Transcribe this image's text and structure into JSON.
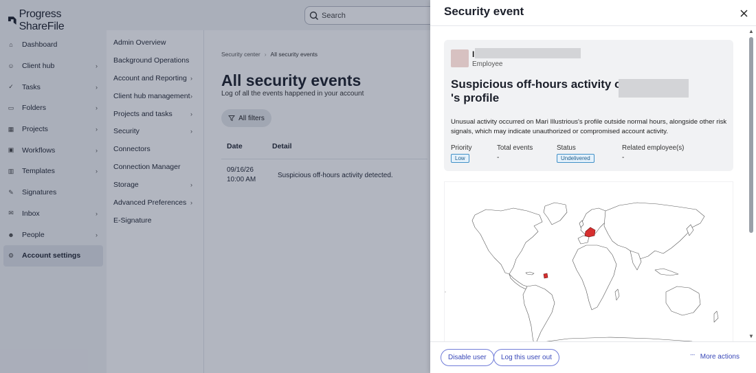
{
  "app": {
    "brand": "Progress ShareFile",
    "search": {
      "placeholder": "Search",
      "value": ""
    },
    "sidebar": {
      "items": [
        {
          "label": "Dashboard",
          "icon": "home-icon",
          "has_submenu": false,
          "active": false
        },
        {
          "label": "Client hub",
          "icon": "client-hub-icon",
          "has_submenu": true,
          "active": false
        },
        {
          "label": "Tasks",
          "icon": "check-icon",
          "has_submenu": true,
          "active": false
        },
        {
          "label": "Folders",
          "icon": "folder-icon",
          "has_submenu": true,
          "active": false
        },
        {
          "label": "Projects",
          "icon": "projects-icon",
          "has_submenu": true,
          "active": false
        },
        {
          "label": "Workflows",
          "icon": "workflow-icon",
          "has_submenu": true,
          "active": false
        },
        {
          "label": "Templates",
          "icon": "template-icon",
          "has_submenu": true,
          "active": false
        },
        {
          "label": "Signatures",
          "icon": "pen-icon",
          "has_submenu": false,
          "active": false
        },
        {
          "label": "Inbox",
          "icon": "inbox-icon",
          "has_submenu": true,
          "active": false
        },
        {
          "label": "People",
          "icon": "people-icon",
          "has_submenu": true,
          "active": false
        },
        {
          "label": "Account settings",
          "icon": "account-settings-icon",
          "has_submenu": false,
          "active": true
        }
      ]
    },
    "settings_menu": {
      "items": [
        {
          "label": "Admin Overview",
          "has_submenu": false
        },
        {
          "label": "Background Operations",
          "has_submenu": false
        },
        {
          "label": "Account and Reporting",
          "has_submenu": true
        },
        {
          "label": "Client hub management",
          "has_submenu": true
        },
        {
          "label": "Projects and tasks",
          "has_submenu": true
        },
        {
          "label": "Security",
          "has_submenu": true
        },
        {
          "label": "Connectors",
          "has_submenu": false
        },
        {
          "label": "Connection Manager",
          "has_submenu": false
        },
        {
          "label": "Storage",
          "has_submenu": true
        },
        {
          "label": "Advanced Preferences",
          "has_submenu": true
        },
        {
          "label": "E-Signature",
          "has_submenu": false
        }
      ]
    },
    "main": {
      "breadcrumb": [
        "Security center",
        "All security events"
      ],
      "title": "All security events",
      "subtitle": "Log of all the events happened in your account",
      "filters_label": "All filters",
      "table": {
        "columns": [
          "Date",
          "Detail"
        ],
        "rows": [
          {
            "date": "09/16/26",
            "time": "10:00 AM",
            "detail": "Suspicious off-hours activity detected."
          }
        ]
      }
    }
  },
  "drawer": {
    "title": "Security event",
    "user": {
      "initial": "I",
      "role": "Employee"
    },
    "event": {
      "title_prefix": "Suspicious off-hours activity on",
      "title_suffix": "'s profile",
      "description": "Unusual activity occurred on Mari Illustrious's profile outside normal hours, alongside other risk signals, which may indicate unauthorized or compromised account activity.",
      "priority_label": "Priority",
      "priority_value": "Low",
      "total_events_label": "Total events",
      "total_events_value": "-",
      "status_label": "Status",
      "status_value": "Undelivered",
      "related_label": "Related employee(s)",
      "related_value": "-"
    },
    "map": {
      "highlight_color": "#d62f2f",
      "highlighted_regions": [
        "France",
        "French Guiana"
      ]
    },
    "footer": {
      "disable_user": "Disable user",
      "log_out_user": "Log this user out",
      "more_actions": "More actions"
    }
  },
  "colors": {
    "accent": "#3847b8",
    "badge_border": "#3f8fc7",
    "overlay": "rgba(30,40,70,0.34)"
  }
}
